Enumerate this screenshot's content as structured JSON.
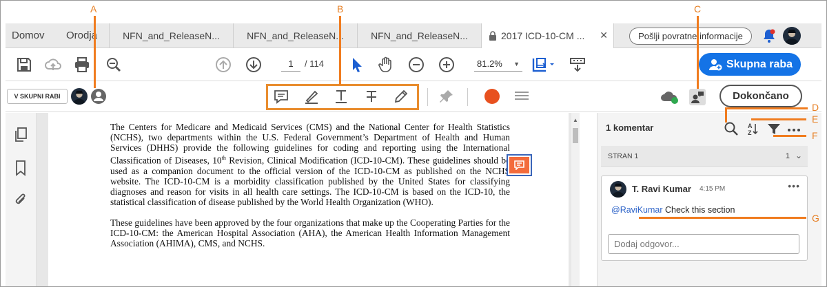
{
  "tabs": {
    "nav_home": "Domov",
    "nav_tools": "Orodja",
    "items": [
      {
        "label": "NFN_and_ReleaseN..."
      },
      {
        "label": "NFN_and_ReleaseN..."
      },
      {
        "label": "NFN_and_ReleaseN..."
      },
      {
        "label": "2017 ICD-10-CM ..."
      }
    ],
    "close_glyph": "✕",
    "feedback": "Pošlji povratne informacije"
  },
  "toolbar": {
    "page_current": "1",
    "page_total": "/ 114",
    "zoom": "81.2%",
    "share": "Skupna raba"
  },
  "comment_toolbar": {
    "shared_badge": "V SKUPNI RABI",
    "done": "Dokončano",
    "highlight_color": "#e8511f"
  },
  "document": {
    "paragraph1_part1": "The Centers for Medicare and Medicaid Services (CMS) and the National Center for Health Statistics (NCHS), two departments within the U.S. Federal Government’s Department of Health and Human Services (DHHS) provide the following guidelines for coding and reporting using the International Classification of Diseases, 10",
    "paragraph1_sup": "th",
    "paragraph1_part2": " Revision, Clinical Modification (ICD-10-CM). These guidelines should be used as a companion document to the official version of the ICD-10-CM as published on the NCHS website. The ICD-10-CM is a morbidity classification published by the United States for classifying diagnoses and reason for visits in all health care settings.  The ICD-10-CM is based on the ICD-10, the statistical classification of disease published by the World Health Organization (WHO).",
    "paragraph2": "These guidelines have been approved by the four organizations that make up the Cooperating Parties for the ICD-10-CM: the American Hospital Association (AHA), the American Health Information Management Association (AHIMA), CMS, and NCHS."
  },
  "comments_pane": {
    "count": "1 komentar",
    "section_label": "STRAN 1",
    "section_count": "1",
    "comment": {
      "author": "T. Ravi Kumar",
      "time": "4:15 PM",
      "mention": "@RaviKumar",
      "text": " Check this section"
    },
    "reply_placeholder": "Dodaj odgovor..."
  },
  "callouts": {
    "a": "A",
    "b": "B",
    "c": "C",
    "d": "D",
    "e": "E",
    "f": "F",
    "g": "G"
  },
  "colors": {
    "accent": "#1473e6",
    "callout": "#f07c1f",
    "comment_marker": "#f36b3b",
    "mention": "#2d63c8"
  }
}
